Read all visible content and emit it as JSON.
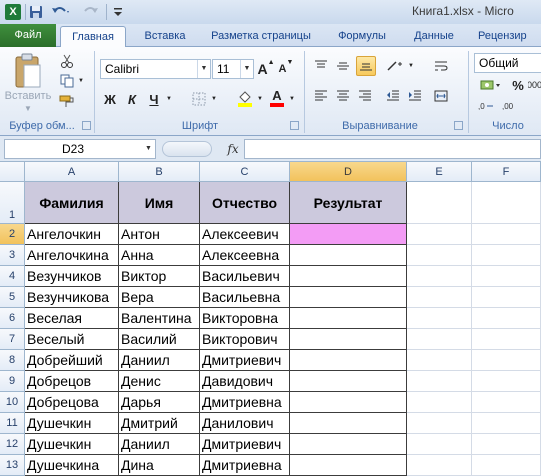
{
  "titlebar": {
    "title": "Книга1.xlsx - Micro",
    "app_icon": "X"
  },
  "tabs": {
    "file": "Файл",
    "home": "Главная",
    "insert": "Вставка",
    "page_layout": "Разметка страницы",
    "formulas": "Формулы",
    "data": "Данные",
    "review": "Рецензир"
  },
  "ribbon": {
    "clipboard": {
      "paste": "Вставить",
      "label": "Буфер обм..."
    },
    "font": {
      "name": "Calibri",
      "size": "11",
      "grow": "A",
      "shrink": "A",
      "bold": "Ж",
      "italic": "К",
      "underline": "Ч",
      "font_color_letter": "A",
      "label": "Шрифт",
      "fill_color": "#ffff00",
      "font_color": "#ff0000"
    },
    "alignment": {
      "label": "Выравнивание"
    },
    "number": {
      "format": "Общий",
      "percent": "%",
      "comma": "000",
      "label": "Число"
    }
  },
  "formula_bar": {
    "name_box": "D23",
    "fx": "fx",
    "value": ""
  },
  "sheet": {
    "columns": [
      "A",
      "B",
      "C",
      "D",
      "E",
      "F"
    ],
    "active_column": "D",
    "active_row": 2,
    "header_row": {
      "row": "1",
      "cells": [
        "Фамилия",
        "Имя",
        "Отчество",
        "Результат"
      ]
    },
    "rows": [
      {
        "row": "2",
        "cells": [
          "Ангелочкин",
          "Антон",
          "Алексеевич",
          ""
        ]
      },
      {
        "row": "3",
        "cells": [
          "Ангелочкина",
          "Анна",
          "Алексеевна",
          ""
        ]
      },
      {
        "row": "4",
        "cells": [
          "Везунчиков",
          "Виктор",
          "Васильевич",
          ""
        ]
      },
      {
        "row": "5",
        "cells": [
          "Везунчикова",
          "Вера",
          "Васильевна",
          ""
        ]
      },
      {
        "row": "6",
        "cells": [
          "Веселая",
          "Валентина",
          "Викторовна",
          ""
        ]
      },
      {
        "row": "7",
        "cells": [
          "Веселый",
          "Василий",
          "Викторович",
          ""
        ]
      },
      {
        "row": "8",
        "cells": [
          "Добрейший",
          "Даниил",
          "Дмитриевич",
          ""
        ]
      },
      {
        "row": "9",
        "cells": [
          "Добрецов",
          "Денис",
          "Давидович",
          ""
        ]
      },
      {
        "row": "10",
        "cells": [
          "Добрецова",
          "Дарья",
          "Дмитриевна",
          ""
        ]
      },
      {
        "row": "11",
        "cells": [
          "Душечкин",
          "Дмитрий",
          "Данилович",
          ""
        ]
      },
      {
        "row": "12",
        "cells": [
          "Душечкин",
          "Даниил",
          "Дмитриевич",
          ""
        ]
      },
      {
        "row": "13",
        "cells": [
          "Душечкина",
          "Дина",
          "Дмитриевна",
          ""
        ]
      }
    ],
    "header_fill": "#ccc9dd",
    "selected_fill": "#f39cf5"
  }
}
